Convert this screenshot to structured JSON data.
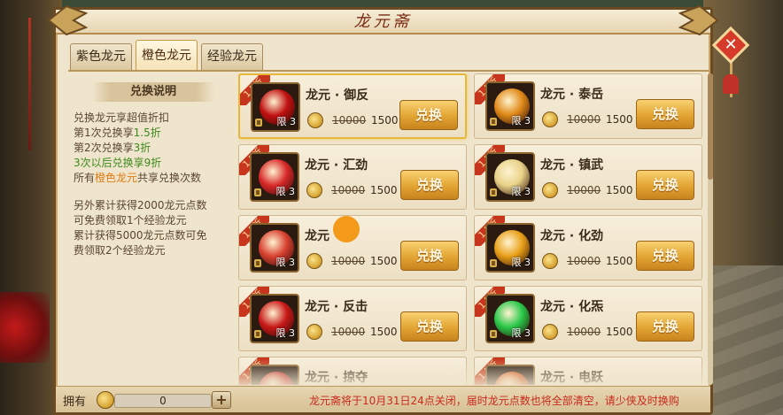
{
  "window": {
    "title": "龙元斋"
  },
  "tabs": [
    {
      "label": "紫色龙元",
      "active": false
    },
    {
      "label": "橙色龙元",
      "active": true
    },
    {
      "label": "经验龙元",
      "active": false
    }
  ],
  "rules": {
    "title": "兑换说明",
    "l1": "兑换龙元享超值折扣",
    "l2a": "第1次兑换享",
    "l2b": "1.5折",
    "l3a": "第2次兑换享",
    "l3b": "3折",
    "l4a": "3次以后兑换享",
    "l4b": "9折",
    "l5a": "所有",
    "l5b": "橙色龙元",
    "l5c": "共享兑换次数",
    "l6": "另外累计获得2000龙元点数",
    "l7": "可免费领取1个经验龙元",
    "l8": "累计获得5000龙元点数可免",
    "l9": "费领取2个经验龙元"
  },
  "items": [
    {
      "name": "龙元 · 御反",
      "discount": "1.5折",
      "limit": "限 3",
      "orig": "10000",
      "price": "1500",
      "btn": "兑换",
      "color": "#c01010"
    },
    {
      "name": "龙元 · 泰岳",
      "discount": "1.5折",
      "limit": "限 3",
      "orig": "10000",
      "price": "1500",
      "btn": "兑换",
      "color": "#e08a18"
    },
    {
      "name": "龙元 · 汇劲",
      "discount": "1.5折",
      "limit": "限 3",
      "orig": "10000",
      "price": "1500",
      "btn": "兑换",
      "color": "#d82828"
    },
    {
      "name": "龙元 · 镇武",
      "discount": "1.5折",
      "limit": "限 3",
      "orig": "10000",
      "price": "1500",
      "btn": "兑换",
      "color": "#e8d288"
    },
    {
      "name": "龙元 · ",
      "discount": "1.5折",
      "limit": "限 3",
      "orig": "10000",
      "price": "1500",
      "btn": "兑换",
      "color": "#d84030"
    },
    {
      "name": "龙元 · 化劲",
      "discount": "1.5折",
      "limit": "限 3",
      "orig": "10000",
      "price": "1500",
      "btn": "兑换",
      "color": "#e8a018"
    },
    {
      "name": "龙元 · 反击",
      "discount": "1.5折",
      "limit": "限 3",
      "orig": "10000",
      "price": "1500",
      "btn": "兑换",
      "color": "#c81818"
    },
    {
      "name": "龙元 · 化炁",
      "discount": "1.5折",
      "limit": "限 3",
      "orig": "10000",
      "price": "1500",
      "btn": "兑换",
      "color": "#28c848"
    },
    {
      "name": "龙元 · 掠夺",
      "discount": "1.5折",
      "limit": "",
      "orig": "",
      "price": "",
      "btn": "",
      "color": "#c02020"
    },
    {
      "name": "龙元 · 电跃",
      "discount": "1.5折",
      "limit": "",
      "orig": "",
      "price": "",
      "btn": "",
      "color": "#d05018"
    }
  ],
  "bottom": {
    "own_label": "拥有",
    "own_value": "0",
    "plus": "+",
    "notice": "龙元斋将于10月31日24点关闭，届时龙元点数也将全部清空，请少侠及时换购"
  },
  "close": "✕"
}
